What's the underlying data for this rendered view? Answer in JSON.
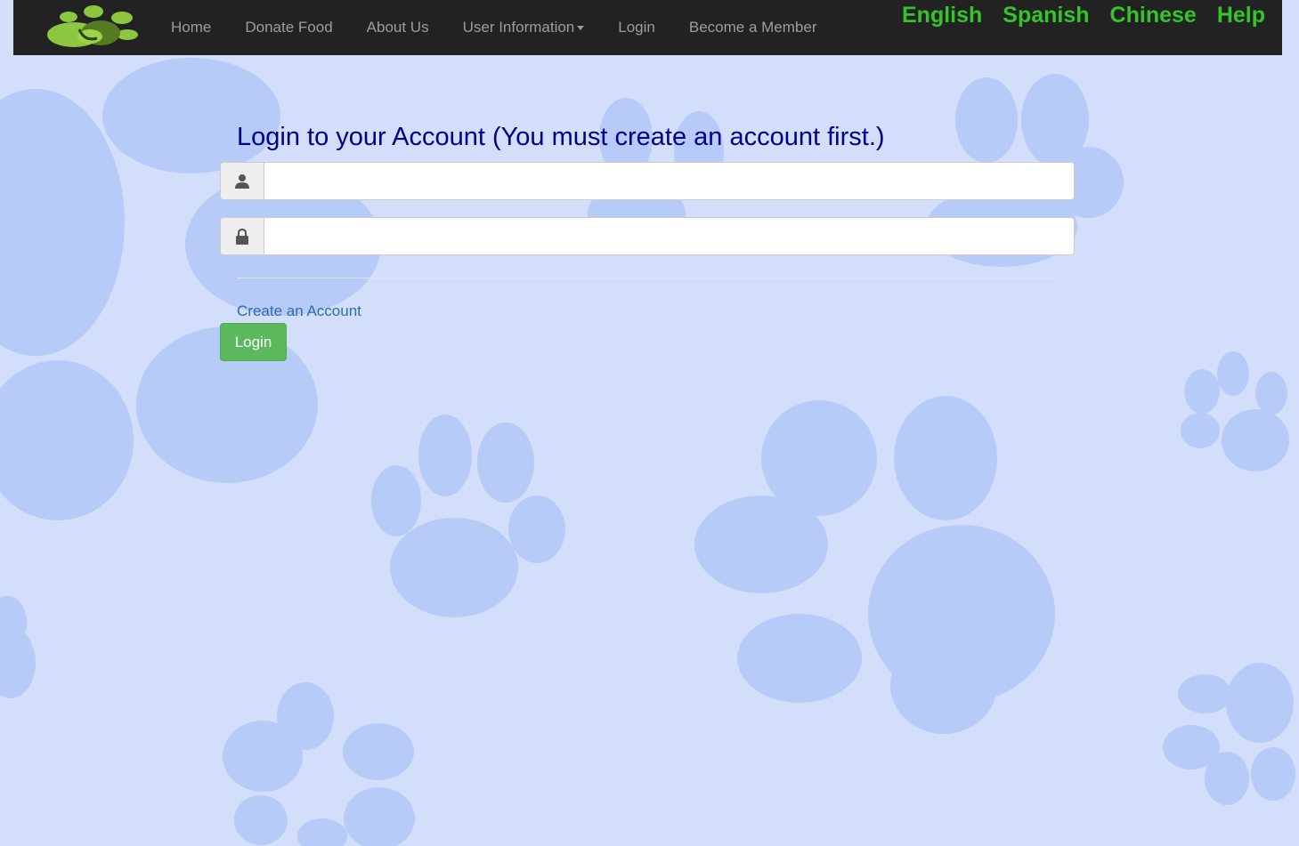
{
  "nav": {
    "items": [
      {
        "label": "Home"
      },
      {
        "label": "Donate Food"
      },
      {
        "label": "About Us"
      },
      {
        "label": "User Information"
      },
      {
        "label": "Login"
      },
      {
        "label": "Become a Member"
      }
    ],
    "languages": [
      {
        "label": "English"
      },
      {
        "label": "Spanish"
      },
      {
        "label": "Chinese"
      },
      {
        "label": "Help"
      }
    ]
  },
  "main": {
    "title": "Login to your Account (You must create an account first.)",
    "username": {
      "placeholder": "",
      "value": "",
      "icon": "user-icon"
    },
    "password": {
      "placeholder": "",
      "value": "",
      "icon": "lock-icon"
    },
    "create_account_label": "Create an Account",
    "login_button_label": "Login"
  },
  "colors": {
    "background": "#d3dffa",
    "paw_prints": "#b7cbf8",
    "navbar": "#222222",
    "nav_text": "#9d9d9d",
    "language_links": "#33c52a",
    "title": "#00008b",
    "link": "#2a6cb0",
    "login_button": "#5cb85c",
    "logo": "#8dc63f"
  }
}
